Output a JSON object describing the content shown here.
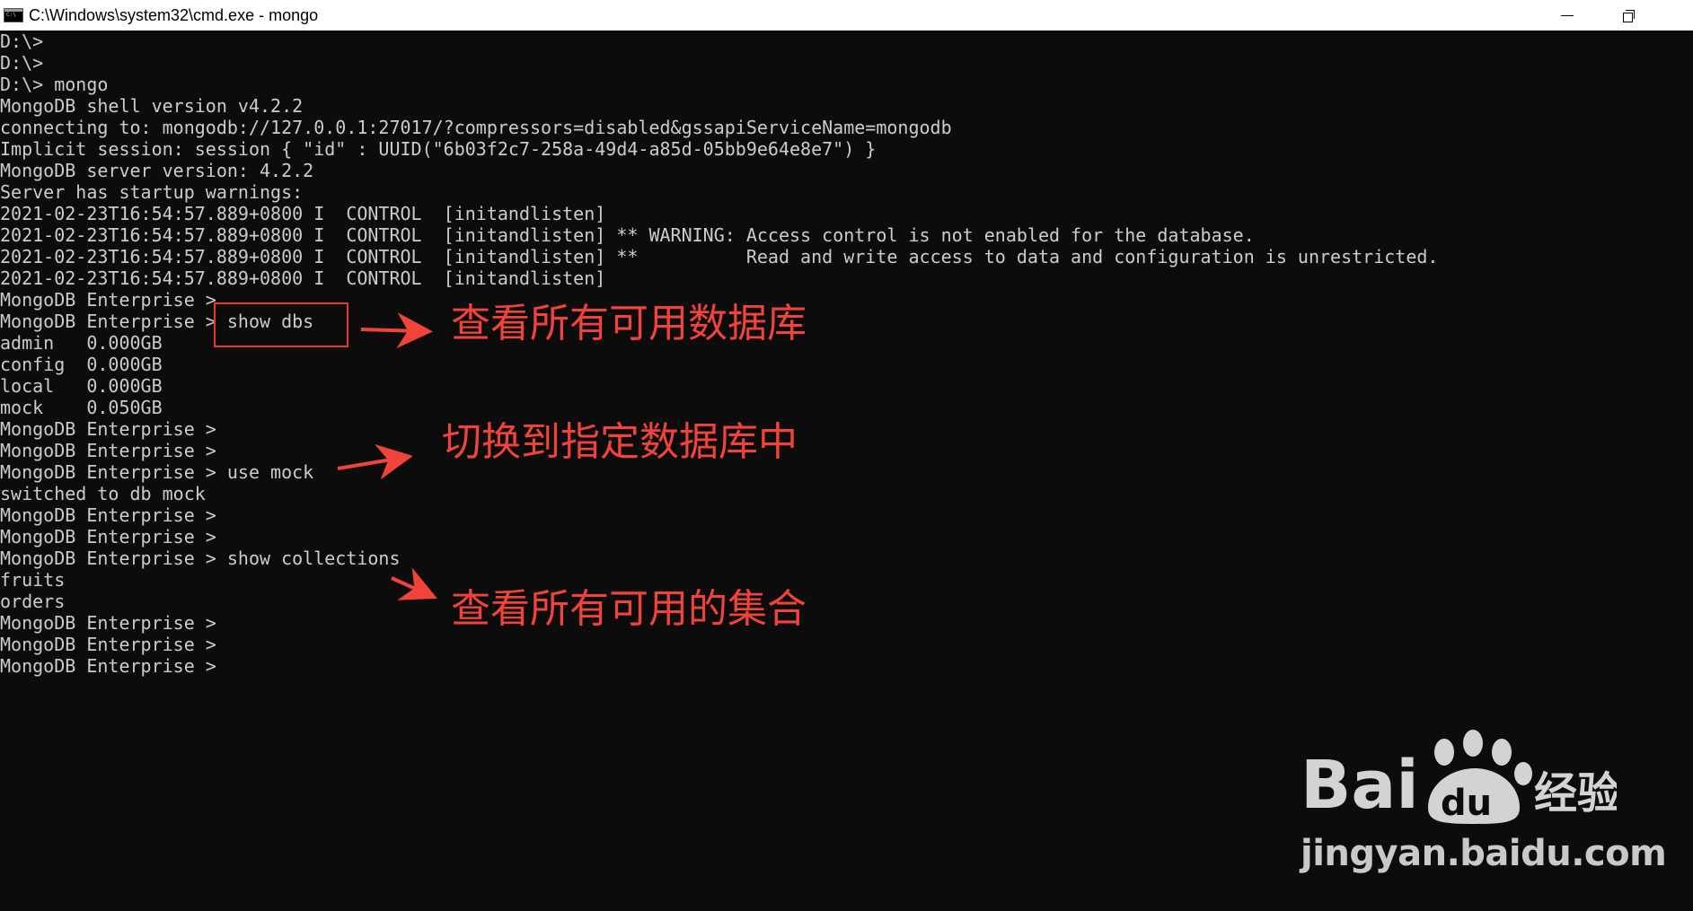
{
  "window": {
    "title": "C:\\Windows\\system32\\cmd.exe - mongo",
    "icon": "console-icon",
    "controls": {
      "minimize": "minimize-icon",
      "maximize": "restore-icon"
    }
  },
  "console": {
    "lines": [
      "D:\\>",
      "D:\\>",
      "D:\\> mongo",
      "MongoDB shell version v4.2.2",
      "connecting to: mongodb://127.0.0.1:27017/?compressors=disabled&gssapiServiceName=mongodb",
      "Implicit session: session { \"id\" : UUID(\"6b03f2c7-258a-49d4-a85d-05bb9e64e8e7\") }",
      "MongoDB server version: 4.2.2",
      "Server has startup warnings:",
      "2021-02-23T16:54:57.889+0800 I  CONTROL  [initandlisten]",
      "2021-02-23T16:54:57.889+0800 I  CONTROL  [initandlisten] ** WARNING: Access control is not enabled for the database.",
      "2021-02-23T16:54:57.889+0800 I  CONTROL  [initandlisten] **          Read and write access to data and configuration is unrestricted.",
      "2021-02-23T16:54:57.889+0800 I  CONTROL  [initandlisten]",
      "MongoDB Enterprise >",
      "MongoDB Enterprise > show dbs",
      "admin   0.000GB",
      "config  0.000GB",
      "local   0.000GB",
      "mock    0.050GB",
      "MongoDB Enterprise >",
      "MongoDB Enterprise >",
      "MongoDB Enterprise > use mock",
      "switched to db mock",
      "MongoDB Enterprise >",
      "MongoDB Enterprise >",
      "MongoDB Enterprise > show collections",
      "fruits",
      "orders",
      "MongoDB Enterprise >",
      "MongoDB Enterprise >",
      "MongoDB Enterprise >"
    ]
  },
  "annotations": {
    "show_dbs": "查看所有可用数据库",
    "use_db": "切换到指定数据库中",
    "show_collections": "查看所有可用的集合",
    "color": "#f0443a"
  },
  "watermark": {
    "logo_text": "Bai",
    "logo_text_2": "du",
    "logo_cn": "经验",
    "url": "jingyan.baidu.com"
  }
}
